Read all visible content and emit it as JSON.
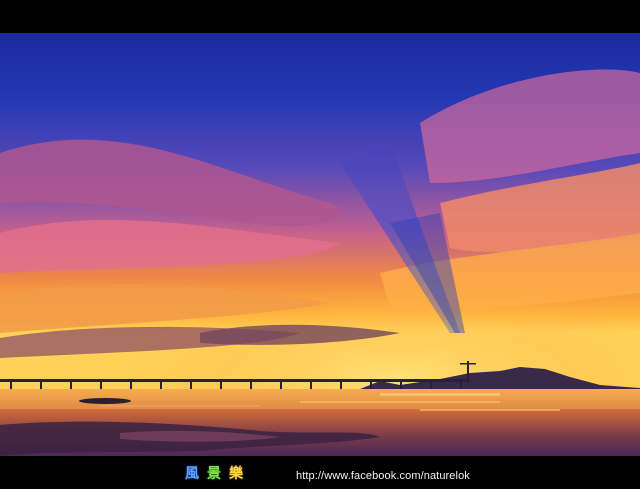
{
  "footer": {
    "logo_chars": [
      "風",
      "景",
      "樂"
    ],
    "url": "http://www.facebook.com/naturelok"
  },
  "colors": {
    "sky_top": "#1b2fa8",
    "sky_mid": "#3a43b8",
    "cloud_pink": "#e06a8e",
    "cloud_orange": "#f28a3c",
    "horizon_gold": "#ffc23a",
    "water": "#c86a3a"
  }
}
